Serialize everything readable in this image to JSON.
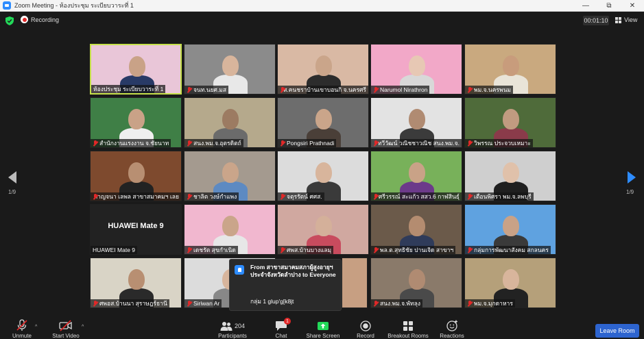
{
  "window": {
    "title": "Zoom Meeting - ห้องประชุม ระเบียบวาระที่ 1",
    "minimize": "—",
    "maximize": "⧉",
    "close": "✕"
  },
  "topbar": {
    "recording_label": "Recording",
    "timer": "00:01:10",
    "view_label": "View"
  },
  "pagination": {
    "left": "1/9",
    "right": "1/9"
  },
  "participants": [
    {
      "name": "ห้องประชุม ระเบียบวาระที่ 1",
      "muted": false,
      "active": true,
      "bg": "#e9c6d8",
      "skin": "#c9a287",
      "shirt": "#283a66"
    },
    {
      "name": "จนท.นยศ.มส",
      "muted": true,
      "active": false,
      "bg": "#8b8b8b",
      "skin": "#d8b59c",
      "shirt": "#e8e8e8"
    },
    {
      "name": "ส.คนชราบ้านเขาบอนกิ จ.นครศรี",
      "muted": true,
      "active": false,
      "bg": "#d9b9a4",
      "skin": "#caa58a",
      "shirt": "#2c2c2c"
    },
    {
      "name": "Narumol Nirathron",
      "muted": true,
      "active": false,
      "bg": "#f2a8c8",
      "skin": "#e7c8b4",
      "shirt": "#d8d8d8"
    },
    {
      "name": "พม.จ.นครพนม",
      "muted": true,
      "active": false,
      "bg": "#c9a97f",
      "skin": "#c89c7c",
      "shirt": "#e9e4d8"
    },
    {
      "name": "สำนักงานแรงงาน จ.ชัยนาท",
      "muted": true,
      "active": false,
      "bg": "#3f7f46",
      "skin": "#c9a287",
      "shirt": "#efefef"
    },
    {
      "name": "สนง.พม.จ.อุตรดิตถ์",
      "muted": true,
      "active": false,
      "bg": "#b5a98c",
      "skin": "#9c7b62",
      "shirt": "#6b6b6b"
    },
    {
      "name": "Pongsiri Prathnadi",
      "muted": true,
      "active": false,
      "bg": "#6d6d6d",
      "skin": "#caa58a",
      "shirt": "#4a3f38"
    },
    {
      "name": "ทวีวัฒน์ วณิชชาวณิช สนง.พม.จ.",
      "muted": true,
      "active": false,
      "bg": "#e3e3e3",
      "skin": "#b08b72",
      "shirt": "#3b3b3b"
    },
    {
      "name": "วิพรรณ ประจวบเหมาะ",
      "muted": true,
      "active": false,
      "bg": "#4f6b3a",
      "skin": "#c19b80",
      "shirt": "#8a3b4a"
    },
    {
      "name": "กาญจนา เลพล สาขาสมาคมฯ เลย",
      "muted": true,
      "active": false,
      "bg": "#7e4a2e",
      "skin": "#b88f72",
      "shirt": "#222"
    },
    {
      "name": "ชาลิต วงษ์กำแพง",
      "muted": true,
      "active": false,
      "bg": "#a49a8f",
      "skin": "#caa58a",
      "shirt": "#5d8ac2"
    },
    {
      "name": "จตุรรัตน์ ศศส.",
      "muted": true,
      "active": false,
      "bg": "#dcdcdc",
      "skin": "#d8b59c",
      "shirt": "#3a3a3a"
    },
    {
      "name": "ศรีวรรณ์ สะแก้ว สสว.6 กาฬสินธุ์",
      "muted": true,
      "active": false,
      "bg": "#78b15a",
      "skin": "#c9a287",
      "shirt": "#6c3a8a"
    },
    {
      "name": "เตือนพิศรา พม.จ.ลพบุรี",
      "muted": true,
      "active": false,
      "bg": "#cfcfcf",
      "skin": "#e0c1aa",
      "shirt": "#1f1f1f"
    },
    {
      "name": "HUAWEI Mate 9",
      "muted": false,
      "active": false,
      "bg": "#222222",
      "skin": "",
      "shirt": "",
      "label": "HUAWEI Mate 9"
    },
    {
      "name": "เดชรัต สุขกำเนิด",
      "muted": true,
      "active": false,
      "bg": "#f1b7cf",
      "skin": "#caa58a",
      "shirt": "#e7e7e7"
    },
    {
      "name": "ศพส.บ้านบางแลมุ",
      "muted": true,
      "active": false,
      "bg": "#d0a8a0",
      "skin": "#d4b09a",
      "shirt": "#c84b5e"
    },
    {
      "name": "พล.ต.สุทธิชัย ปานเจิด สาขาฯ",
      "muted": true,
      "active": false,
      "bg": "#6b5a4a",
      "skin": "#b48c70",
      "shirt": "#2f3b5a"
    },
    {
      "name": "กลุ่มการพัฒนาสังคม สกลนคร",
      "muted": true,
      "active": false,
      "bg": "#5fa2e0",
      "skin": "#c9a287",
      "shirt": "#3a3a3a"
    },
    {
      "name": "ศพอส.บ้านนา สุราษฎร์ธานี",
      "muted": true,
      "active": false,
      "bg": "#d9d4c6",
      "skin": "#b88f72",
      "shirt": "#2a2a2a"
    },
    {
      "name": "Siriwan Ar",
      "muted": true,
      "active": false,
      "bg": "#dcdcdc",
      "skin": "#d8b59c",
      "shirt": "#888"
    },
    {
      "name": "",
      "muted": false,
      "active": false,
      "bg": "#c79f82",
      "skin": "#b48c70",
      "shirt": "#444"
    },
    {
      "name": "สนง.พม.จ.พัทลุง",
      "muted": true,
      "active": false,
      "bg": "#8a7a6a",
      "skin": "#b08b72",
      "shirt": "#4a4a4a"
    },
    {
      "name": "พม.จ.มุกดาหาร",
      "muted": true,
      "active": false,
      "bg": "#b5a07a",
      "skin": "#d8b59c",
      "shirt": "#222"
    }
  ],
  "chat_popup": {
    "from": "From สาขาสมาคมสภาผู้สูงอายุฯ ประจำจังหวัดลำปาง to Everyone",
    "message": "กลุ่ม 1 glup'g[k8jt"
  },
  "toolbar": {
    "unmute": "Unmute",
    "start_video": "Start Video",
    "participants": "Participants",
    "participants_count": "204",
    "chat": "Chat",
    "chat_badge": "1",
    "share_screen": "Share Screen",
    "record": "Record",
    "breakout_rooms": "Breakout Rooms",
    "reactions": "Reactions",
    "leave": "Leave Room"
  },
  "colors": {
    "accent": "#2d8cff",
    "share_green": "#23d959",
    "leave_blue": "#2d64cf",
    "active_speaker": "#c5e04a",
    "muted_red": "#e02828"
  }
}
